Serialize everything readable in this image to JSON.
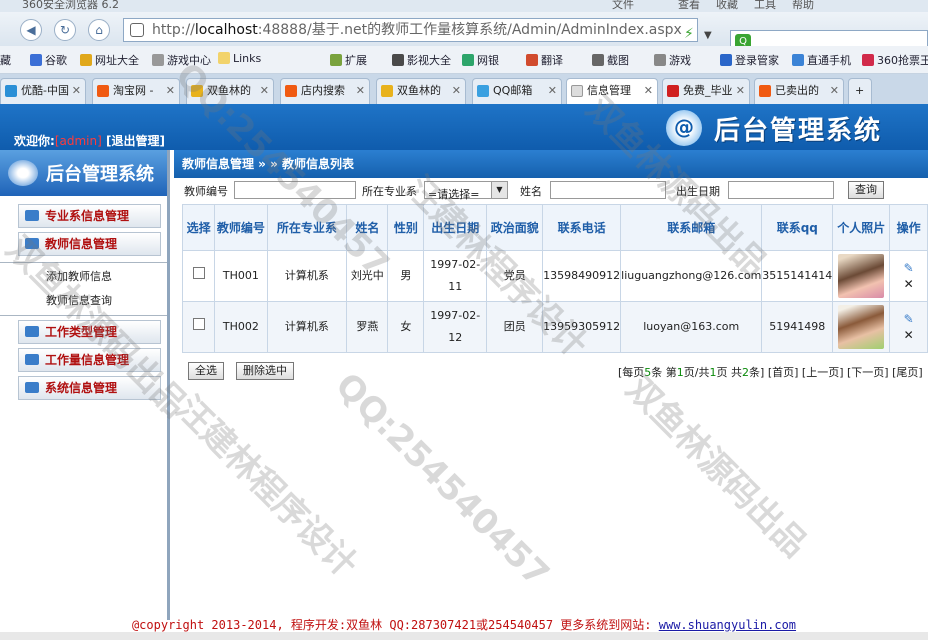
{
  "browser": {
    "title": "360安全浏览器 6.2",
    "menu": [
      "文件",
      "查看",
      "收藏",
      "工具",
      "帮助"
    ],
    "url_host": "localhost",
    "url_rest": ":48888/基于.net的教师工作量核算系统/Admin/AdminIndex.aspx",
    "bookmarks": [
      "谷歌",
      "网址大全",
      "游戏中心",
      "Links",
      "扩展",
      "影视大全",
      "网银",
      "翻译",
      "截图",
      "游戏",
      "登录管家",
      "直通手机",
      "360抢票王"
    ],
    "bookmark_first": "藏",
    "tabs": [
      "优酷-中国",
      "淘宝网 -",
      "双鱼林的",
      "店内搜索",
      "双鱼林的",
      "QQ邮箱",
      "信息管理",
      "免费_毕业",
      "已卖出的"
    ]
  },
  "banner": {
    "welcome": "欢迎你:",
    "user": "[admin]",
    "logout": "[退出管理]",
    "logo_char": "@",
    "title": "后台管理系统"
  },
  "sidebar": {
    "title": "后台管理系统",
    "menus": [
      "专业系信息管理",
      "教师信息管理",
      "工作类型管理",
      "工作量信息管理",
      "系统信息管理"
    ],
    "sub_items": [
      "添加教师信息",
      "教师信息查询"
    ]
  },
  "breadcrumb": "教师信息管理 » » 教师信息列表",
  "filters": {
    "teacher_no_label": "教师编号",
    "dept_label": "所在专业系",
    "dept_selected": "=请选择=",
    "name_label": "姓名",
    "birth_label": "出生日期",
    "query_button": "查询"
  },
  "table": {
    "headers": [
      "选择",
      "教师编号",
      "所在专业系",
      "姓名",
      "性别",
      "出生日期",
      "政治面貌",
      "联系电话",
      "联系邮箱",
      "联系qq",
      "个人照片",
      "操作"
    ],
    "rows": [
      {
        "no": "TH001",
        "dept": "计算机系",
        "name": "刘光中",
        "sex": "男",
        "birth": "1997-02-11",
        "politics": "党员",
        "phone": "13598490912",
        "email": "liuguangzhong@126.com",
        "qq": "3515141414"
      },
      {
        "no": "TH002",
        "dept": "计算机系",
        "name": "罗燕",
        "sex": "女",
        "birth": "1997-02-12",
        "politics": "团员",
        "phone": "13959305912",
        "email": "luoyan@163.com",
        "qq": "51941498"
      }
    ]
  },
  "actions": {
    "select_all": "全选",
    "delete_selected": "删除选中"
  },
  "pager": {
    "text_a": "[每页",
    "per_page": "5",
    "text_b": "条 第",
    "current": "1",
    "text_c": "页/共",
    "total_pages": "1",
    "text_d": "页 共",
    "total_records": "2",
    "text_e": "条]",
    "first": "[首页]",
    "prev": "[上一页]",
    "next": "[下一页]",
    "last": "[尾页]"
  },
  "footer": {
    "text": "@copyright 2013-2014, 程序开发:双鱼林 QQ:287307421或254540457 更多系统到网站:",
    "link": "www.shuangyulin.com"
  },
  "watermarks": [
    "QQ:254540457",
    "汪建林程序设计",
    "双鱼林源码出品"
  ]
}
